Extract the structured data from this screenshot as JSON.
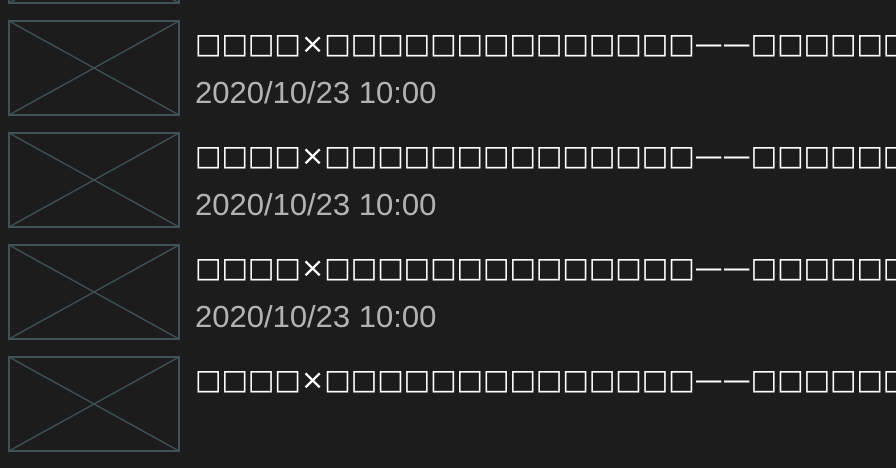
{
  "colors": {
    "background": "#1c1c1c",
    "title_text": "#ffffff",
    "date_text": "#b3b3b3",
    "placeholder_stroke": "#3f5258"
  },
  "articles": [
    {
      "title": "",
      "date": "",
      "thumbnail_icon": "image-placeholder-icon"
    },
    {
      "title": "□□□□×□□□□□□□□□□□□□□——□□□□□□□□□□□□□□□□□□□",
      "date": "2020/10/23 10:00",
      "thumbnail_icon": "image-placeholder-icon"
    },
    {
      "title": "□□□□×□□□□□□□□□□□□□□——□□□□□□□□□□□□□□□□□□□",
      "date": "2020/10/23 10:00",
      "thumbnail_icon": "image-placeholder-icon"
    },
    {
      "title": "□□□□×□□□□□□□□□□□□□□——□□□□□□□□□□□□□□□□□□□",
      "date": "2020/10/23 10:00",
      "thumbnail_icon": "image-placeholder-icon"
    },
    {
      "title": "□□□□×□□□□□□□□□□□□□□——□□□□□□□□□□□□□□□□□□□",
      "date": "",
      "thumbnail_icon": "image-placeholder-icon"
    }
  ]
}
